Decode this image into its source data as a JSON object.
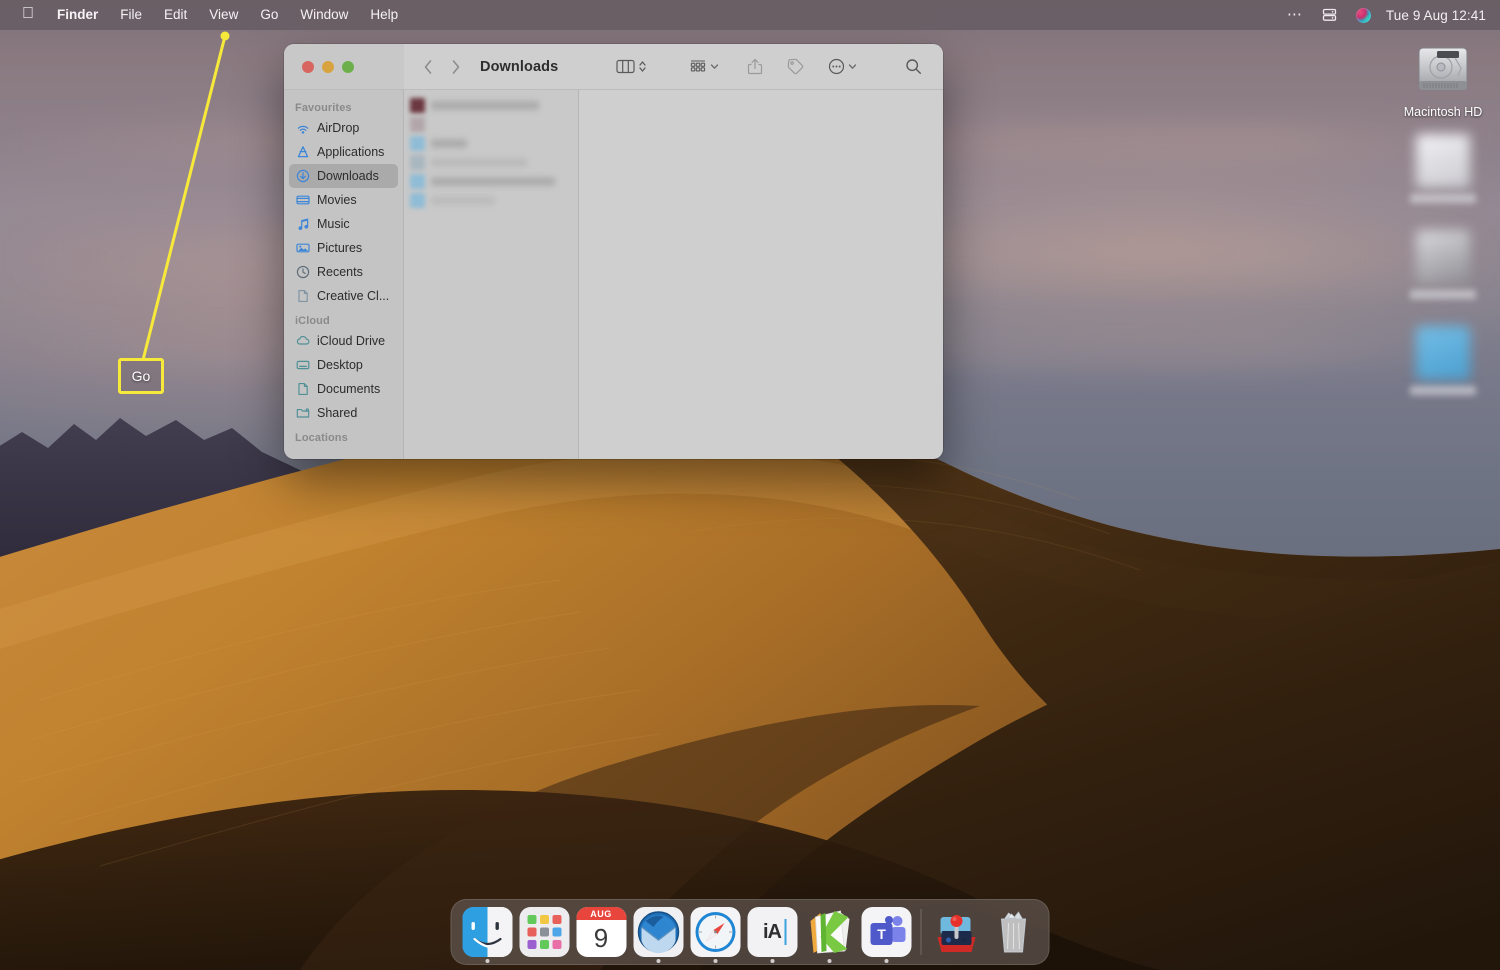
{
  "menubar": {
    "apple_icon": "apple-logo-icon",
    "items": [
      {
        "label": "Finder",
        "bold": true
      },
      {
        "label": "File",
        "bold": false
      },
      {
        "label": "Edit",
        "bold": false
      },
      {
        "label": "View",
        "bold": false
      },
      {
        "label": "Go",
        "bold": false
      },
      {
        "label": "Window",
        "bold": false
      },
      {
        "label": "Help",
        "bold": false
      }
    ],
    "status": {
      "control_center_icon": "control-center-dots-icon",
      "screen_mirroring_icon": "screen-mirroring-icon",
      "siri_icon": "siri-orb-icon",
      "clock": "Tue 9 Aug  12:41"
    }
  },
  "desktop": {
    "icons": [
      {
        "name": "Macintosh HD",
        "icon": "hard-drive-icon",
        "blurred": false
      },
      {
        "name": "",
        "icon": "blurred-desktop-icon",
        "blurred": true
      },
      {
        "name": "",
        "icon": "blurred-desktop-icon",
        "blurred": true
      },
      {
        "name": "",
        "icon": "blurred-desktop-icon",
        "blurred": true
      }
    ]
  },
  "finder": {
    "title": "Downloads",
    "traffic_lights": [
      "close-button",
      "minimize-button",
      "zoom-button"
    ],
    "nav": {
      "back_icon": "chevron-left-icon",
      "forward_icon": "chevron-right-icon"
    },
    "toolbar": [
      {
        "name": "view-column-button",
        "icon": "column-view-icon"
      },
      {
        "name": "view-stepper",
        "icon": "stepper-updown-icon"
      },
      {
        "name": "group-by-button",
        "icon": "grid-group-icon"
      },
      {
        "name": "share-button",
        "icon": "share-icon"
      },
      {
        "name": "tag-button",
        "icon": "tag-icon"
      },
      {
        "name": "more-actions-button",
        "icon": "ellipsis-circle-icon"
      },
      {
        "name": "search-button",
        "icon": "search-icon"
      }
    ],
    "sidebar": [
      {
        "section": "Favourites",
        "items": [
          {
            "label": "AirDrop",
            "icon": "airdrop-icon",
            "selected": false
          },
          {
            "label": "Applications",
            "icon": "applications-icon",
            "selected": false
          },
          {
            "label": "Downloads",
            "icon": "downloads-icon",
            "selected": true
          },
          {
            "label": "Movies",
            "icon": "movies-icon",
            "selected": false
          },
          {
            "label": "Music",
            "icon": "music-icon",
            "selected": false
          },
          {
            "label": "Pictures",
            "icon": "pictures-icon",
            "selected": false
          },
          {
            "label": "Recents",
            "icon": "recents-clock-icon",
            "selected": false
          },
          {
            "label": "Creative Cl...",
            "icon": "document-icon",
            "selected": false
          }
        ]
      },
      {
        "section": "iCloud",
        "items": [
          {
            "label": "iCloud Drive",
            "icon": "cloud-icon",
            "selected": false
          },
          {
            "label": "Desktop",
            "icon": "desktop-icon",
            "selected": false
          },
          {
            "label": "Documents",
            "icon": "document-icon",
            "selected": false
          },
          {
            "label": "Shared",
            "icon": "shared-folder-icon",
            "selected": false
          }
        ]
      },
      {
        "section": "Locations",
        "items": []
      }
    ],
    "file_list": [
      {
        "icon_color": "#6b3740",
        "name_width": 108,
        "blurred": true
      },
      {
        "icon_color": "#b3a6ab",
        "name_width": 0,
        "blurred": true
      },
      {
        "icon_color": "#8fbcd6",
        "name_width": 36,
        "blurred": true
      },
      {
        "icon_color": "#a9b7c0",
        "name_width": 96,
        "blurred": true
      },
      {
        "icon_color": "#8fbcd6",
        "name_width": 124,
        "blurred": true
      },
      {
        "icon_color": "#8fbcd6",
        "name_width": 64,
        "blurred": true
      }
    ]
  },
  "callout": {
    "label": "Go",
    "border_color": "#f7e93a",
    "target": "menubar-item-go"
  },
  "dock": {
    "items": [
      {
        "label": "Finder",
        "icon": "finder-icon",
        "running": true
      },
      {
        "label": "Launchpad",
        "icon": "launchpad-icon",
        "running": false
      },
      {
        "label": "Calendar",
        "icon": "calendar-icon",
        "running": false,
        "month": "AUG",
        "day": "9"
      },
      {
        "label": "Thunderbird",
        "icon": "thunderbird-icon",
        "running": true
      },
      {
        "label": "Safari",
        "icon": "safari-icon",
        "running": true
      },
      {
        "label": "iA Writer",
        "icon": "ia-writer-icon",
        "running": true,
        "glyph": "iA"
      },
      {
        "label": "Kindle",
        "icon": "kindle-k-icon",
        "running": true
      },
      {
        "label": "Microsoft Teams",
        "icon": "microsoft-teams-icon",
        "running": true
      }
    ],
    "right_items": [
      {
        "label": "Arcade",
        "icon": "joystick-icon",
        "running": false
      },
      {
        "label": "Trash",
        "icon": "trash-icon",
        "running": false
      }
    ]
  }
}
